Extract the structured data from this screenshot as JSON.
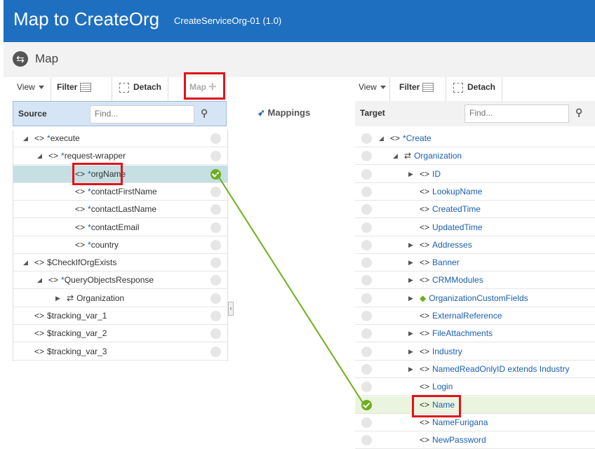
{
  "header": {
    "title": "Map to CreateOrg",
    "subtitle": "CreateServiceOrg-01 (1.0)"
  },
  "mapbar": {
    "label": "Map",
    "icon": "map-arrows-icon"
  },
  "source_toolbar": {
    "view": "View",
    "filter": "Filter",
    "detach": "Detach",
    "map": "Map"
  },
  "target_toolbar": {
    "view": "View",
    "filter": "Filter",
    "detach": "Detach"
  },
  "source": {
    "title": "Source",
    "find_placeholder": "Find..."
  },
  "mappings": {
    "label": "Mappings"
  },
  "target": {
    "title": "Target",
    "find_placeholder": "Find..."
  },
  "source_tree": [
    {
      "label": "execute",
      "star": "*",
      "prefix": "<>",
      "tri": "◢",
      "mapped": false
    },
    {
      "label": "request-wrapper",
      "star": "*",
      "prefix": "<>",
      "tri": "◢",
      "mapped": false
    },
    {
      "label": "orgName",
      "star": "*",
      "prefix": "<>",
      "tri": "",
      "mapped": true
    },
    {
      "label": "contactFirstName",
      "star": "*",
      "prefix": "<>",
      "tri": "",
      "mapped": false
    },
    {
      "label": "contactLastName",
      "star": "*",
      "prefix": "<>",
      "tri": "",
      "mapped": false
    },
    {
      "label": "contactEmail",
      "star": "*",
      "prefix": "<>",
      "tri": "",
      "mapped": false
    },
    {
      "label": "country",
      "star": "*",
      "prefix": "<>",
      "tri": "",
      "mapped": false
    },
    {
      "label": "$CheckIfOrgExists",
      "star": "",
      "prefix": "<>",
      "tri": "◢",
      "mapped": false
    },
    {
      "label": "QueryObjectsResponse",
      "star": "*",
      "prefix": "<>",
      "tri": "◢",
      "mapped": false
    },
    {
      "label": "Organization",
      "star": "",
      "prefix": "⇄",
      "tri": "▶",
      "mapped": false
    },
    {
      "label": "$tracking_var_1",
      "star": "",
      "prefix": "<>",
      "tri": "",
      "mapped": false
    },
    {
      "label": "$tracking_var_2",
      "star": "",
      "prefix": "<>",
      "tri": "",
      "mapped": false
    },
    {
      "label": "$tracking_var_3",
      "star": "",
      "prefix": "<>",
      "tri": "",
      "mapped": false
    }
  ],
  "target_tree": [
    {
      "label": "Create",
      "star": "*",
      "prefix": "<>",
      "tri": "◢",
      "mapped": false
    },
    {
      "label": "Organization",
      "star": "",
      "prefix": "⇄",
      "tri": "◢",
      "mapped": false
    },
    {
      "label": "ID",
      "star": "",
      "prefix": "<>",
      "tri": "▶",
      "mapped": false
    },
    {
      "label": "LookupName",
      "star": "",
      "prefix": "<>",
      "tri": "",
      "mapped": false
    },
    {
      "label": "CreatedTime",
      "star": "",
      "prefix": "<>",
      "tri": "",
      "mapped": false
    },
    {
      "label": "UpdatedTime",
      "star": "",
      "prefix": "<>",
      "tri": "",
      "mapped": false
    },
    {
      "label": "Addresses",
      "star": "",
      "prefix": "<>",
      "tri": "▶",
      "mapped": false
    },
    {
      "label": "Banner",
      "star": "",
      "prefix": "<>",
      "tri": "▶",
      "mapped": false
    },
    {
      "label": "CRMModules",
      "star": "",
      "prefix": "<>",
      "tri": "▶",
      "mapped": false
    },
    {
      "label": "OrganizationCustomFields",
      "star": "",
      "prefix": "◆",
      "tri": "▶",
      "mapped": false
    },
    {
      "label": "ExternalReference",
      "star": "",
      "prefix": "<>",
      "tri": "",
      "mapped": false
    },
    {
      "label": "FileAttachments",
      "star": "",
      "prefix": "<>",
      "tri": "▶",
      "mapped": false
    },
    {
      "label": "Industry",
      "star": "",
      "prefix": "<>",
      "tri": "▶",
      "mapped": false
    },
    {
      "label": "NamedReadOnlyID extends Industry",
      "star": "",
      "prefix": "<>",
      "tri": "▶",
      "mapped": false
    },
    {
      "label": "Login",
      "star": "",
      "prefix": "<>",
      "tri": "",
      "mapped": false
    },
    {
      "label": "Name",
      "star": "",
      "prefix": "<>",
      "tri": "",
      "mapped": true
    },
    {
      "label": "NameFurigana",
      "star": "",
      "prefix": "<>",
      "tri": "",
      "mapped": false
    },
    {
      "label": "NewPassword",
      "star": "",
      "prefix": "<>",
      "tri": "",
      "mapped": false
    }
  ],
  "colors": {
    "header": "#1f6fc0",
    "selected_row": "#c5dfe3",
    "mapped_row": "#eaf4de",
    "mapping_line": "#6eaf1e",
    "highlight_box": "#e0131b"
  }
}
